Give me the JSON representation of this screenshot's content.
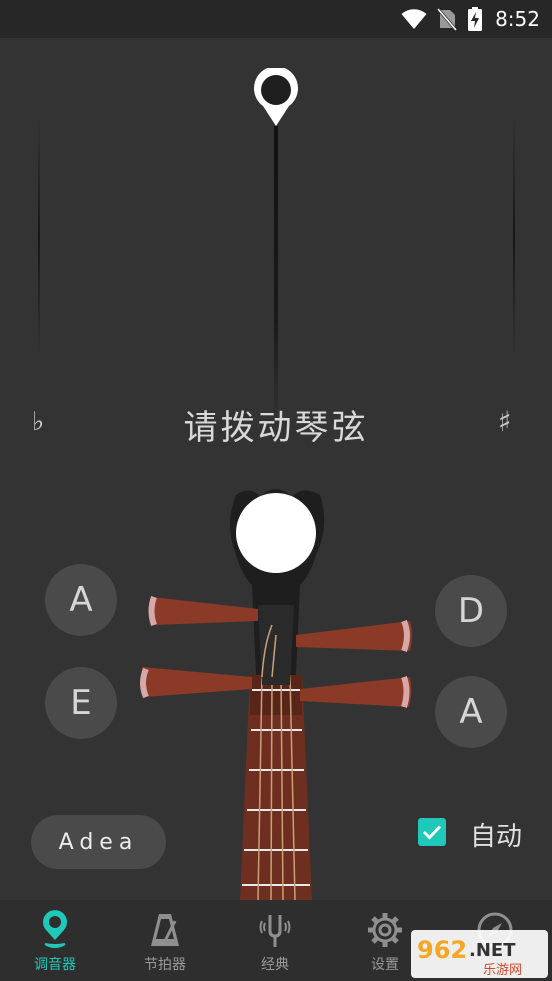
{
  "status_bar": {
    "time": "8:52"
  },
  "tuner": {
    "prompt": "请拨动琴弦",
    "flat_symbol": "♭",
    "sharp_symbol": "♯",
    "strings_left": [
      "A",
      "E"
    ],
    "strings_right": [
      "D",
      "A"
    ],
    "preset": "Adea",
    "auto_label": "自动",
    "auto_checked": true
  },
  "nav": {
    "items": [
      {
        "label": "调音器",
        "icon": "tuner-pin-icon",
        "active": true
      },
      {
        "label": "节拍器",
        "icon": "metronome-icon",
        "active": false
      },
      {
        "label": "经典",
        "icon": "tuning-fork-icon",
        "active": false
      },
      {
        "label": "设置",
        "icon": "gear-icon",
        "active": false
      },
      {
        "label": "",
        "icon": "compass-icon",
        "active": false
      }
    ]
  },
  "watermark": {
    "brand": "962.NET",
    "subtitle": "乐游网"
  },
  "colors": {
    "accent": "#1fc8b8",
    "background": "#333333",
    "button": "#4a4a4a",
    "peg": "#8a3a26"
  }
}
